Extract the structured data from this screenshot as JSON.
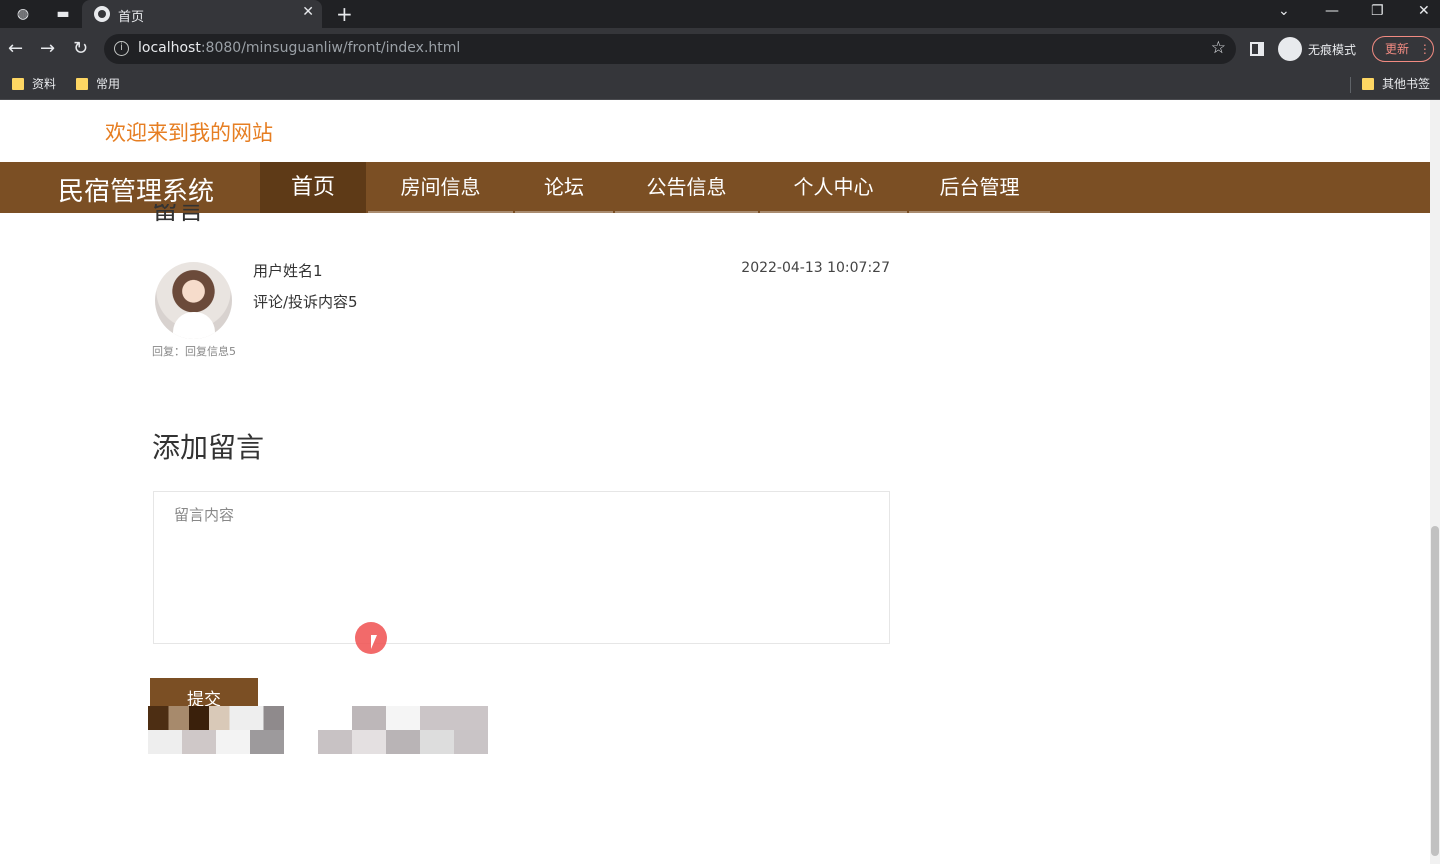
{
  "browser": {
    "tab_title": "首页",
    "url_host": "localhost",
    "url_rest": ":8080/minsuguanliw/front/index.html",
    "incognito_label": "无痕模式",
    "update_label": "更新",
    "bookmarks": [
      "资料",
      "常用"
    ],
    "other_bookmarks": "其他书签"
  },
  "site": {
    "welcome": "欢迎来到我的网站",
    "brand": "民宿管理系统",
    "nav": [
      "首页",
      "房间信息",
      "论坛",
      "公告信息",
      "个人中心",
      "后台管理"
    ]
  },
  "comments_section": {
    "title_partial": "留言",
    "items": [
      {
        "user": "用户姓名1",
        "content": "评论/投诉内容5",
        "time": "2022-04-13 10:07:27",
        "reply": "回复：回复信息5"
      }
    ]
  },
  "add_comment": {
    "title": "添加留言",
    "placeholder": "留言内容",
    "submit_label": "提交"
  },
  "colors": {
    "brand_brown": "#7b4f24",
    "active_nav": "#5e3a17",
    "welcome_orange": "#e67e22"
  }
}
